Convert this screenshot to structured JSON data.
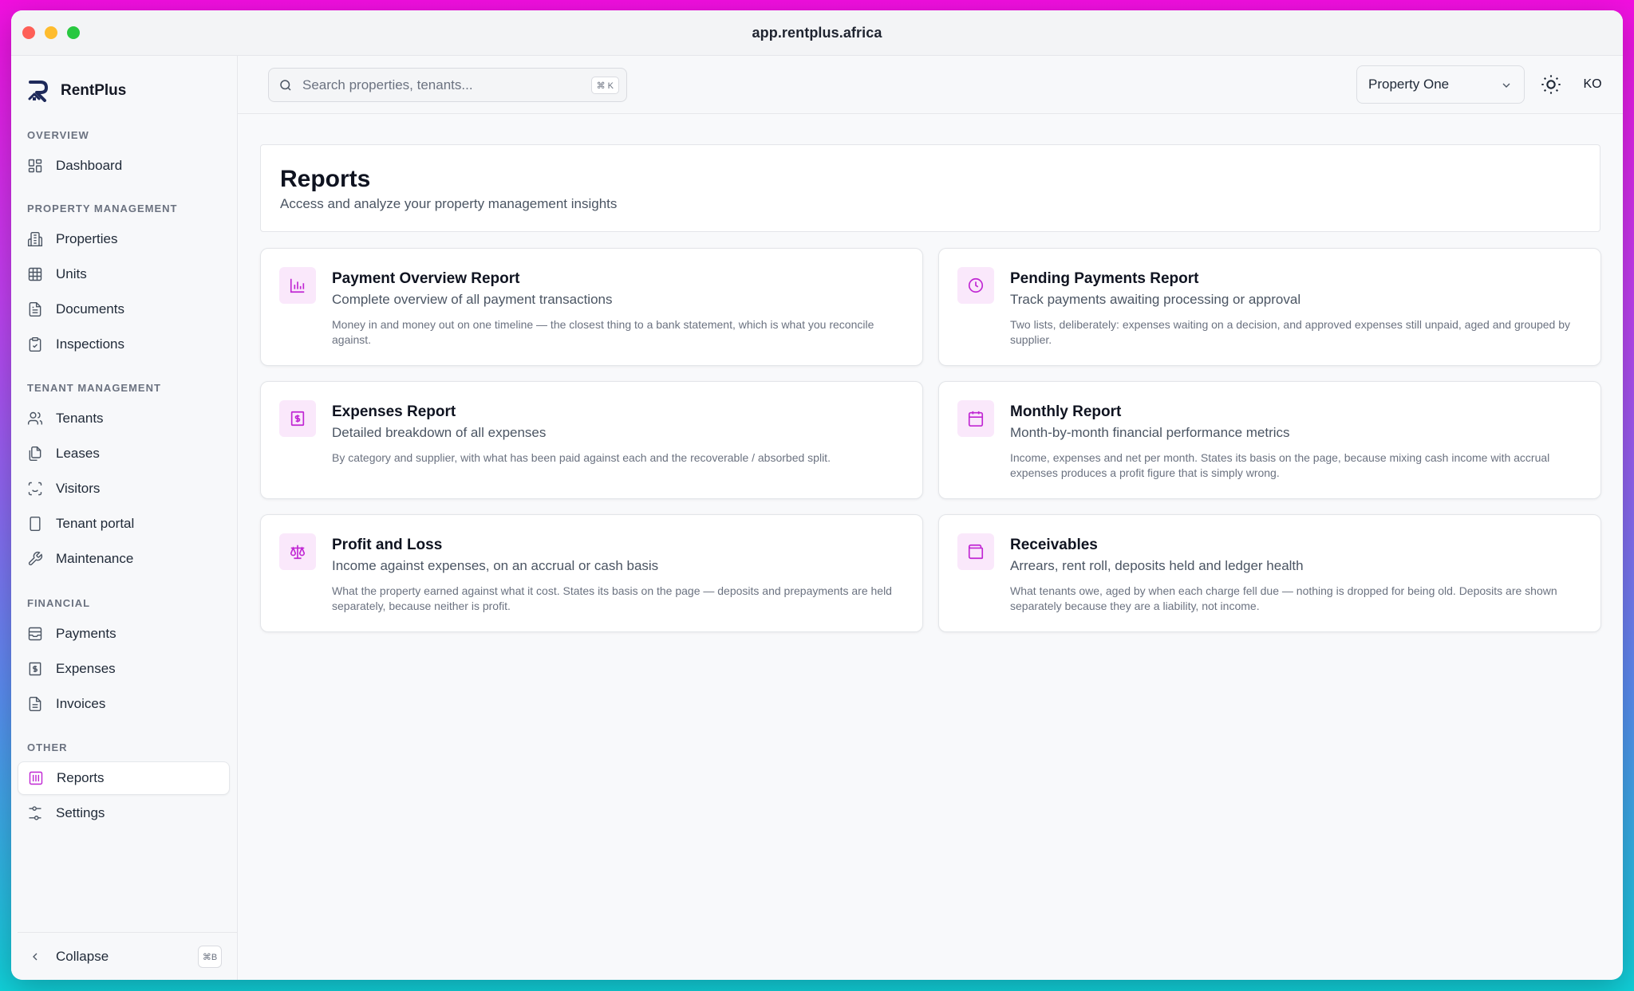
{
  "window": {
    "url": "app.rentplus.africa"
  },
  "brand": {
    "name": "RentPlus"
  },
  "sidebar": {
    "sections": [
      {
        "label": "OVERVIEW",
        "items": [
          {
            "label": "Dashboard",
            "icon": "dashboard-icon"
          }
        ]
      },
      {
        "label": "PROPERTY MANAGEMENT",
        "items": [
          {
            "label": "Properties",
            "icon": "building-icon"
          },
          {
            "label": "Units",
            "icon": "grid-icon"
          },
          {
            "label": "Documents",
            "icon": "document-icon"
          },
          {
            "label": "Inspections",
            "icon": "clipboard-check-icon"
          }
        ]
      },
      {
        "label": "TENANT MANAGEMENT",
        "items": [
          {
            "label": "Tenants",
            "icon": "users-icon"
          },
          {
            "label": "Leases",
            "icon": "files-icon"
          },
          {
            "label": "Visitors",
            "icon": "scan-face-icon"
          },
          {
            "label": "Tenant portal",
            "icon": "smartphone-icon"
          },
          {
            "label": "Maintenance",
            "icon": "wrench-icon"
          }
        ]
      },
      {
        "label": "FINANCIAL",
        "items": [
          {
            "label": "Payments",
            "icon": "inbox-icon"
          },
          {
            "label": "Expenses",
            "icon": "receipt-dollar-icon"
          },
          {
            "label": "Invoices",
            "icon": "file-text-icon"
          }
        ]
      },
      {
        "label": "OTHER",
        "items": [
          {
            "label": "Reports",
            "icon": "reports-icon",
            "active": true
          },
          {
            "label": "Settings",
            "icon": "sliders-icon"
          }
        ]
      }
    ],
    "collapse": {
      "label": "Collapse",
      "shortcut": "⌘B"
    }
  },
  "topbar": {
    "search": {
      "placeholder": "Search properties, tenants...",
      "shortcut": "⌘ K"
    },
    "property_select": {
      "value": "Property One"
    },
    "avatar_initials": "KO"
  },
  "page": {
    "title": "Reports",
    "subtitle": "Access and analyze your property management insights"
  },
  "reports": [
    {
      "title": "Payment Overview Report",
      "subtitle": "Complete overview of all payment transactions",
      "description": "Money in and money out on one timeline — the closest thing to a bank statement, which is what you reconcile against.",
      "icon": "bar-chart-icon"
    },
    {
      "title": "Pending Payments Report",
      "subtitle": "Track payments awaiting processing or approval",
      "description": "Two lists, deliberately: expenses waiting on a decision, and approved expenses still unpaid, aged and grouped by supplier.",
      "icon": "clock-icon"
    },
    {
      "title": "Expenses Report",
      "subtitle": "Detailed breakdown of all expenses",
      "description": "By category and supplier, with what has been paid against each and the recoverable / absorbed split.",
      "icon": "receipt-dollar-icon"
    },
    {
      "title": "Monthly Report",
      "subtitle": "Month-by-month financial performance metrics",
      "description": "Income, expenses and net per month. States its basis on the page, because mixing cash income with accrual expenses produces a profit figure that is simply wrong.",
      "icon": "calendar-icon"
    },
    {
      "title": "Profit and Loss",
      "subtitle": "Income against expenses, on an accrual or cash basis",
      "description": "What the property earned against what it cost. States its basis on the page — deposits and prepayments are held separately, because neither is profit.",
      "icon": "scale-icon"
    },
    {
      "title": "Receivables",
      "subtitle": "Arrears, rent roll, deposits held and ledger health",
      "description": "What tenants owe, aged by when each charge fell due — nothing is dropped for being old. Deposits are shown separately because they are a liability, not income.",
      "icon": "wallet-icon"
    }
  ],
  "colors": {
    "accent": "#c026d3",
    "accent_bg": "#fae8fb"
  }
}
